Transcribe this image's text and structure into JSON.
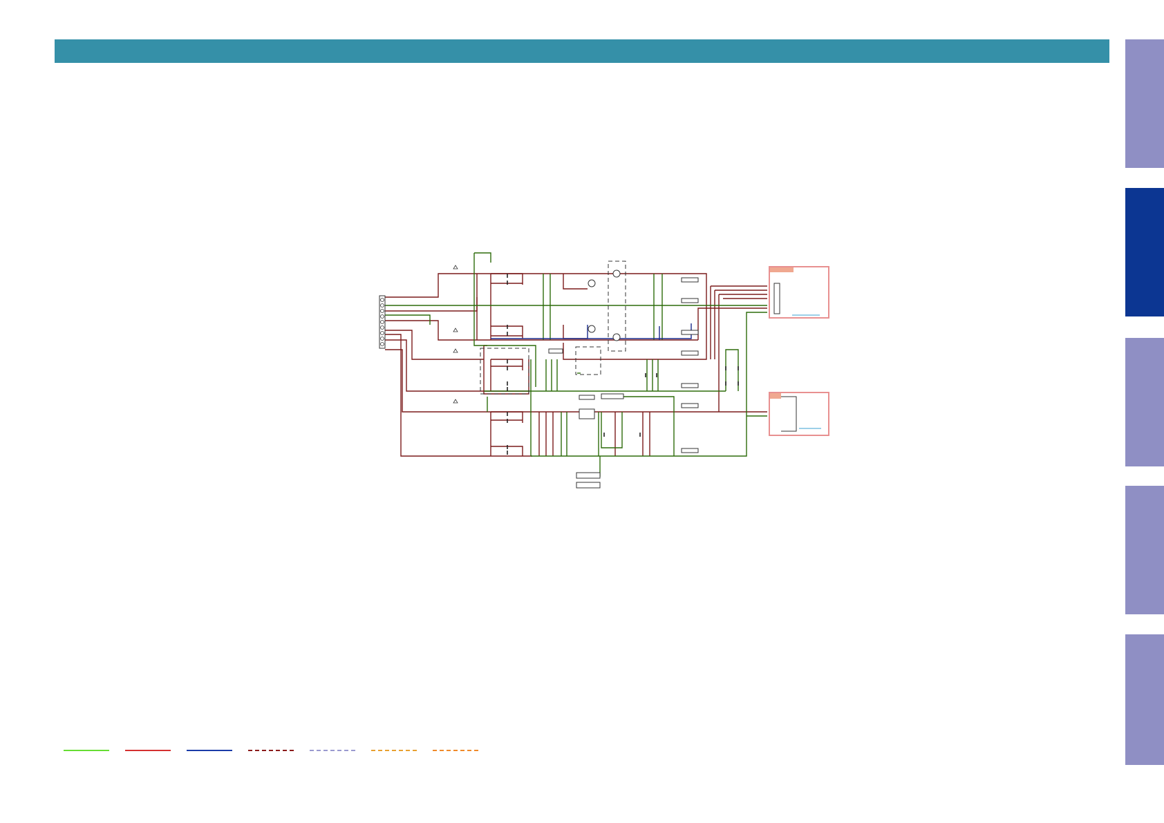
{
  "header": {
    "title": "",
    "color": "#3590a8"
  },
  "side_tabs": [
    {
      "label": "",
      "state": "inactive"
    },
    {
      "label": "",
      "state": "active"
    },
    {
      "label": "",
      "state": "inactive"
    },
    {
      "label": "",
      "state": "inactive"
    },
    {
      "label": "",
      "state": "inactive"
    }
  ],
  "colors": {
    "tab_inactive": "#8f8fc4",
    "tab_active": "#0c3692",
    "wire_power": "#7a1a1a",
    "wire_ground": "#2d6b0a",
    "wire_signal": "#1a2a8c",
    "connector_box": "#e89090",
    "connector_tag": "#f0a890"
  },
  "legend": [
    {
      "style": "solid",
      "color": "#66dd33"
    },
    {
      "style": "solid",
      "color": "#d43030"
    },
    {
      "style": "solid",
      "color": "#1a3ba8"
    },
    {
      "style": "dashed",
      "color": "#8b1a1a"
    },
    {
      "style": "dashed",
      "color": "#9a9ad0"
    },
    {
      "style": "dashed",
      "color": "#e8a030"
    },
    {
      "style": "dashed",
      "color": "#f08a2a"
    }
  ]
}
